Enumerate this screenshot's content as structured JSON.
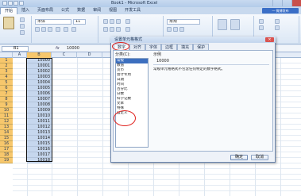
{
  "window": {
    "title": "Book1 - Microsoft Excel"
  },
  "ribbon_tabs": [
    "开始",
    "插入",
    "页面布局",
    "公式",
    "数据",
    "审阅",
    "视图",
    "开发工具"
  ],
  "help_text": "— 微博发布",
  "font_box": {
    "font_name": "宋体",
    "font_size": "11"
  },
  "number_format_box": {
    "value": "常规"
  },
  "formula_bar": {
    "name_box": "B1",
    "fx": "fx",
    "value": "10000"
  },
  "columns": [
    "A",
    "B",
    "C",
    "D",
    "E",
    "F",
    "G",
    "H",
    "I",
    "J"
  ],
  "rows": {
    "numbers": [
      "1",
      "2",
      "3",
      "4",
      "5",
      "6",
      "7",
      "8",
      "9",
      "10",
      "11",
      "12",
      "13",
      "14",
      "15",
      "16",
      "17",
      "18",
      "19"
    ],
    "values": [
      "10000",
      "10001",
      "10002",
      "10003",
      "10004",
      "10005",
      "10006",
      "10007",
      "10008",
      "10009",
      "10010",
      "10011",
      "10012",
      "10013",
      "10014",
      "10015",
      "10016",
      "10017",
      "10018"
    ]
  },
  "dialog": {
    "title": "设置单元格格式",
    "close": "×",
    "tabs": [
      "数字",
      "对齐",
      "字体",
      "边框",
      "填充",
      "保护"
    ],
    "category_label": "分类(C):",
    "categories": [
      "常规",
      "数值",
      "货币",
      "会计专用",
      "日期",
      "时间",
      "百分比",
      "分数",
      "科学记数",
      "文本",
      "特殊",
      "自定义"
    ],
    "selected_category": "常规",
    "sample_label": "示例",
    "sample_value": "10000",
    "description": "常规单元格格式不包含任何特定的数字格式。",
    "ok": "确定",
    "cancel": "取消"
  },
  "colors": {
    "accent": "#3c6fbf",
    "annotation": "#e0201c",
    "row_highlight": "#f7c76c"
  }
}
